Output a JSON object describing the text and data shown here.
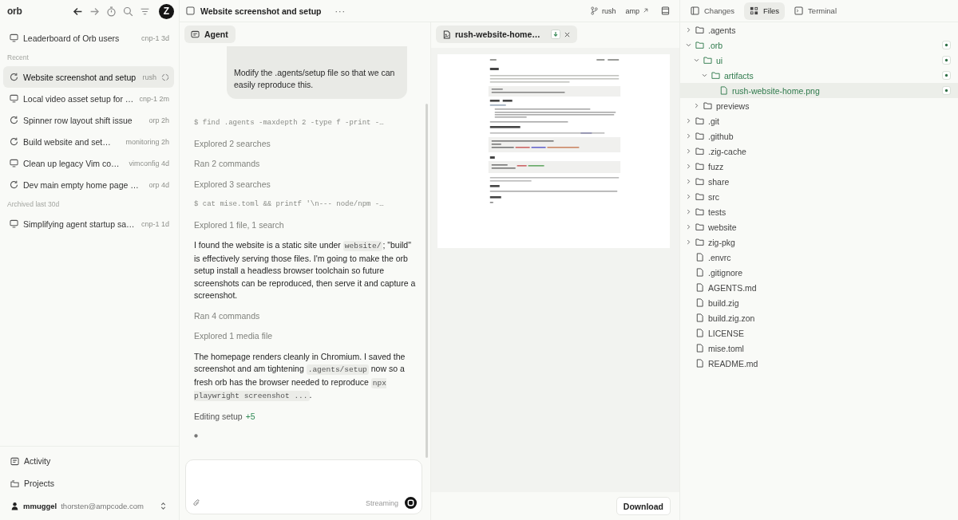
{
  "sidebar": {
    "logo": "orb",
    "avatar": "Z",
    "pinned": [
      {
        "kind": "local",
        "title": "Leaderboard of Orb users",
        "meta": "cnp-1 3d",
        "selected": false,
        "running": false
      }
    ],
    "sections": [
      {
        "heading": "Recent",
        "items": [
          {
            "kind": "remote",
            "title": "Website screenshot and setup",
            "meta": "rush",
            "selected": true,
            "running": true
          },
          {
            "kind": "local",
            "title": "Local video asset setup for …",
            "meta": "cnp-1 2m",
            "selected": false,
            "running": false
          },
          {
            "kind": "remote",
            "title": "Spinner row layout shift issue",
            "meta": "orp 2h",
            "selected": false,
            "running": false
          },
          {
            "kind": "remote",
            "title": "Build website and set…",
            "meta": "monitoring 2h",
            "selected": false,
            "running": false
          },
          {
            "kind": "local",
            "title": "Clean up legacy Vim co…",
            "meta": "vimconfig 4d",
            "selected": false,
            "running": false
          },
          {
            "kind": "remote",
            "title": "Dev main empty home page …",
            "meta": "orp 4d",
            "selected": false,
            "running": false
          }
        ]
      },
      {
        "heading": "Archived last 30d",
        "items": [
          {
            "kind": "local",
            "title": "Simplifying agent startup sa…",
            "meta": "cnp-1 1d",
            "selected": false,
            "running": false
          }
        ]
      }
    ],
    "nav": [
      {
        "kind": "activity",
        "label": "Activity"
      },
      {
        "kind": "projects",
        "label": "Projects"
      }
    ],
    "account": {
      "name": "mmuggel",
      "email": "thorsten@ampcode.com"
    }
  },
  "thread": {
    "title": "Website screenshot and setup",
    "more": "···",
    "branch": "rush",
    "link": "amp"
  },
  "chat": {
    "tabs": [
      {
        "label": "Agent",
        "selected": true
      }
    ],
    "user_message": "Modify the .agents/setup file so that we can easily reproduce this.",
    "steps": [
      {
        "kind": "command",
        "text": "$ find .agents -maxdepth 2 -type f -print -…"
      },
      {
        "kind": "summary",
        "text": "Explored 2 searches"
      },
      {
        "kind": "summary",
        "text": "Ran 2 commands"
      },
      {
        "kind": "summary",
        "text": "Explored 3 searches"
      },
      {
        "kind": "command",
        "text": "$ cat mise.toml && printf '\\n--- node/npm -…"
      },
      {
        "kind": "summary",
        "text": "Explored 1 file, 1 search"
      },
      {
        "kind": "message",
        "segments": [
          {
            "kind": "text",
            "text": "I found the website is a static site under "
          },
          {
            "kind": "code",
            "text": "website/"
          },
          {
            "kind": "text",
            "text": "; \"build\" is effectively serving those files. I'm going to make the orb setup install a headless browser toolchain so future screenshots can be reproduced, then serve it and capture a screenshot."
          }
        ]
      },
      {
        "kind": "summary",
        "text": "Ran 4 commands"
      },
      {
        "kind": "summary",
        "text": "Explored 1 media file"
      },
      {
        "kind": "message",
        "segments": [
          {
            "kind": "text",
            "text": "The homepage renders cleanly in Chromium. I saved the screenshot and am tightening "
          },
          {
            "kind": "code",
            "text": ".agents/setup"
          },
          {
            "kind": "text",
            "text": " now so a fresh orb has the browser needed to reproduce "
          },
          {
            "kind": "code",
            "text": "npx playwright screenshot ..."
          },
          {
            "kind": "text",
            "text": "."
          }
        ]
      },
      {
        "kind": "edit",
        "text": "Editing setup",
        "added": "+5"
      },
      {
        "kind": "pending"
      }
    ],
    "composer": {
      "status": "Streaming"
    }
  },
  "preview": {
    "tabs": [
      {
        "label": "rush-website-home…",
        "selected": true
      }
    ],
    "download": "Download"
  },
  "files": {
    "tabs": [
      {
        "kind": "changes",
        "label": "Changes",
        "selected": false
      },
      {
        "kind": "files",
        "label": "Files",
        "selected": true
      },
      {
        "kind": "terminal",
        "label": "Terminal",
        "selected": false
      }
    ],
    "tree": [
      {
        "kind": "folder",
        "name": ".agents",
        "expanded": false,
        "changed": false,
        "selected": false
      },
      {
        "kind": "folder",
        "name": ".orb",
        "expanded": true,
        "changed": true,
        "selected": false,
        "children": [
          {
            "kind": "folder",
            "name": "ui",
            "expanded": true,
            "changed": true,
            "selected": false,
            "children": [
              {
                "kind": "folder",
                "name": "artifacts",
                "expanded": true,
                "changed": true,
                "selected": false,
                "children": [
                  {
                    "kind": "file",
                    "name": "rush-website-home.png",
                    "changed": true,
                    "selected": true
                  }
                ]
              }
            ]
          },
          {
            "kind": "folder",
            "name": "previews",
            "expanded": false,
            "changed": false,
            "selected": false
          }
        ]
      },
      {
        "kind": "folder",
        "name": ".git",
        "expanded": false,
        "changed": false,
        "selected": false
      },
      {
        "kind": "folder",
        "name": ".github",
        "expanded": false,
        "changed": false,
        "selected": false
      },
      {
        "kind": "folder",
        "name": ".zig-cache",
        "expanded": false,
        "changed": false,
        "selected": false
      },
      {
        "kind": "folder",
        "name": "fuzz",
        "expanded": false,
        "changed": false,
        "selected": false
      },
      {
        "kind": "folder",
        "name": "share",
        "expanded": false,
        "changed": false,
        "selected": false
      },
      {
        "kind": "folder",
        "name": "src",
        "expanded": false,
        "changed": false,
        "selected": false
      },
      {
        "kind": "folder",
        "name": "tests",
        "expanded": false,
        "changed": false,
        "selected": false
      },
      {
        "kind": "folder",
        "name": "website",
        "expanded": false,
        "changed": false,
        "selected": false
      },
      {
        "kind": "folder",
        "name": "zig-pkg",
        "expanded": false,
        "changed": false,
        "selected": false
      },
      {
        "kind": "file",
        "name": ".envrc",
        "changed": false,
        "selected": false
      },
      {
        "kind": "file",
        "name": ".gitignore",
        "changed": false,
        "selected": false
      },
      {
        "kind": "file",
        "name": "AGENTS.md",
        "changed": false,
        "selected": false
      },
      {
        "kind": "file",
        "name": "build.zig",
        "changed": false,
        "selected": false
      },
      {
        "kind": "file",
        "name": "build.zig.zon",
        "changed": false,
        "selected": false
      },
      {
        "kind": "file",
        "name": "LICENSE",
        "changed": false,
        "selected": false
      },
      {
        "kind": "file",
        "name": "mise.toml",
        "changed": false,
        "selected": false
      },
      {
        "kind": "file",
        "name": "README.md",
        "changed": false,
        "selected": false
      }
    ]
  }
}
